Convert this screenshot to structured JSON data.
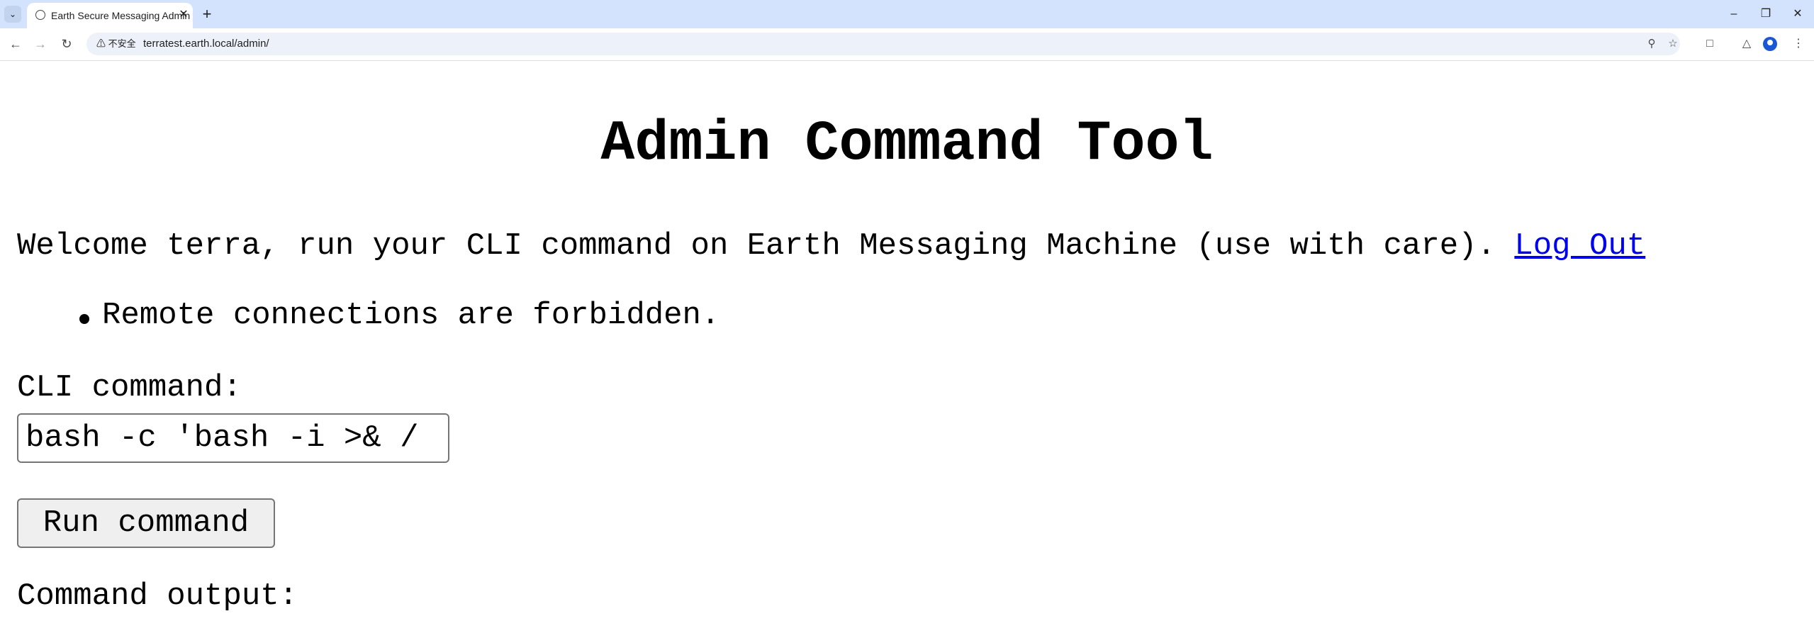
{
  "browser": {
    "tab_title": "Earth Secure Messaging Admin",
    "url": "terratest.earth.local/admin/",
    "security_label": "不安全",
    "icons": [
      "tab-search-icon",
      "globe-icon",
      "close-icon",
      "plus-icon",
      "minimize-icon",
      "restore-icon",
      "window-close-icon",
      "back-icon",
      "forward-icon",
      "reload-icon",
      "warning-icon",
      "zoom-icon",
      "star-icon",
      "extensions-icon",
      "labs-icon",
      "profile-icon",
      "menu-icon"
    ]
  },
  "page": {
    "title": "Admin Command Tool",
    "welcome_text": "Welcome terra, run your CLI command on Earth Messaging Machine (use with care).",
    "logout_link": "Log Out",
    "rules": [
      "Remote connections are forbidden."
    ],
    "cli_label": "CLI command:",
    "cli_value": "bash -c 'bash -i >& /",
    "run_button": "Run command",
    "output_label": "Command output:"
  },
  "colors": {
    "tabstrip": "#d3e3fd",
    "link": "#0000ee"
  }
}
